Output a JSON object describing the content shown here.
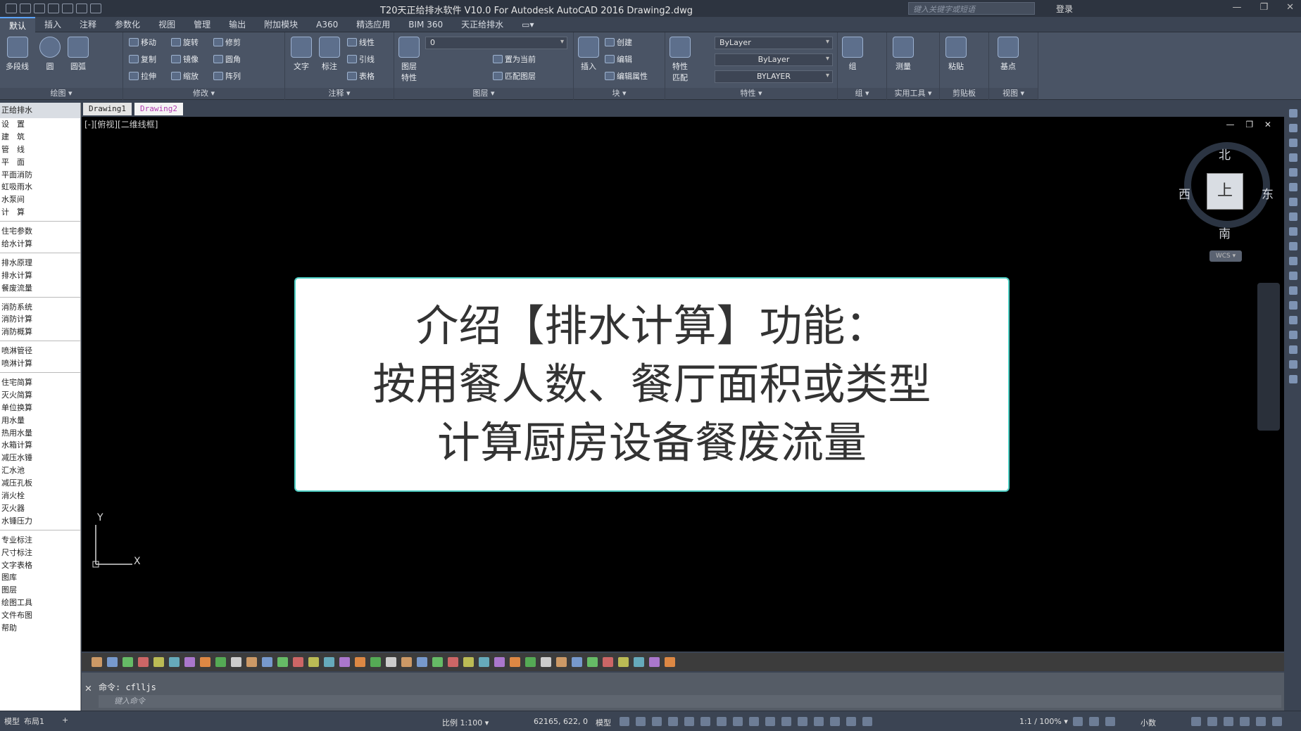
{
  "titlebar": {
    "title": "T20天正给排水软件 V10.0 For Autodesk AutoCAD 2016    Drawing2.dwg",
    "search_placeholder": "键入关键字或短语",
    "login": "登录",
    "window_controls": [
      "—",
      "❐",
      "✕"
    ]
  },
  "ribbon_tabs": [
    "默认",
    "插入",
    "注释",
    "参数化",
    "视图",
    "管理",
    "输出",
    "附加模块",
    "A360",
    "精选应用",
    "BIM 360",
    "天正给排水",
    "▭▾"
  ],
  "ribbon": {
    "draw": {
      "label": "绘图 ▾",
      "polyline": "多段线",
      "circle": "圆",
      "arc": "圆弧"
    },
    "modify": {
      "label": "修改 ▾",
      "move": "移动",
      "rotate": "旋转",
      "trim": "修剪",
      "copy": "复制",
      "mirror": "镜像",
      "fillet": "圆角",
      "stretch": "拉伸",
      "scale": "缩放",
      "array": "阵列"
    },
    "annotate": {
      "label": "注释 ▾",
      "text": "文字",
      "dimension": "标注",
      "linear": "线性",
      "leader": "引线",
      "table": "表格"
    },
    "layers": {
      "label": "图层 ▾",
      "layer_props": "图层特性",
      "layer_current": "0",
      "set_current": "置为当前",
      "match_layer": "匹配图层"
    },
    "block": {
      "label": "块 ▾",
      "insert": "插入",
      "create": "创建",
      "edit": "编辑",
      "edit_attr": "编辑属性"
    },
    "properties": {
      "label": "特性 ▾",
      "match": "特性匹配",
      "color": "ByLayer",
      "linetype": "ByLayer",
      "lineweight": "BYLAYER"
    },
    "group": {
      "label": "组 ▾",
      "group": "组"
    },
    "utilities": {
      "label": "实用工具 ▾",
      "measure": "测量"
    },
    "clipboard": {
      "label": "剪贴板",
      "paste": "粘贴"
    },
    "view": {
      "label": "视图 ▾",
      "base": "基点"
    }
  },
  "doc_tabs": [
    "Drawing1",
    "Drawing2"
  ],
  "left_panel": {
    "header": "正给排水",
    "groups": [
      [
        "设　置",
        "建　筑",
        "管　线",
        "平　面",
        "平面消防",
        "虹吸雨水",
        "水泵间",
        "计　算"
      ],
      [
        "住宅参数",
        "给水计算"
      ],
      [
        "排水原理",
        "排水计算",
        "餐废流量"
      ],
      [
        "消防系统",
        "消防计算",
        "消防概算"
      ],
      [
        "喷淋管径",
        "喷淋计算"
      ],
      [
        "住宅简算",
        "灭火简算",
        "单位换算",
        "用水量",
        "热用水量",
        "水箱计算",
        "减压水锤",
        "汇水池",
        "减压孔板",
        "消火栓",
        "灭火器",
        "水锤压力"
      ],
      [
        "专业标注",
        "尺寸标注",
        "文字表格",
        "图库",
        "图层",
        "绘图工具",
        "文件布图",
        "帮助"
      ]
    ]
  },
  "viewport": {
    "label": "[-][俯视][二维线框]",
    "controls": "— ❐ ✕",
    "compass": {
      "north": "北",
      "south": "南",
      "east": "东",
      "west": "西",
      "cube": "上",
      "wcs": "WCS ▾"
    },
    "ucs_x": "X",
    "ucs_y": "Y"
  },
  "card": {
    "line1": "介绍【排水计算】功能：",
    "line2": "按用餐人数、餐厅面积或类型",
    "line3": "计算厨房设备餐废流量"
  },
  "command": {
    "history": "命令: cflljs",
    "placeholder": "键入命令"
  },
  "status": {
    "layout_tabs": [
      "模型",
      "布局1",
      "+"
    ],
    "scale": "比例 1:100 ▾",
    "coords": "62165, 622, 0",
    "mode": "模型",
    "zoom": "1:1 / 100% ▾",
    "units": "小数"
  },
  "colors": {
    "card_border": "#4fd0c5",
    "active_tab_accent": "#5ca3ff",
    "drawing2_tab": "#b03cb0"
  }
}
